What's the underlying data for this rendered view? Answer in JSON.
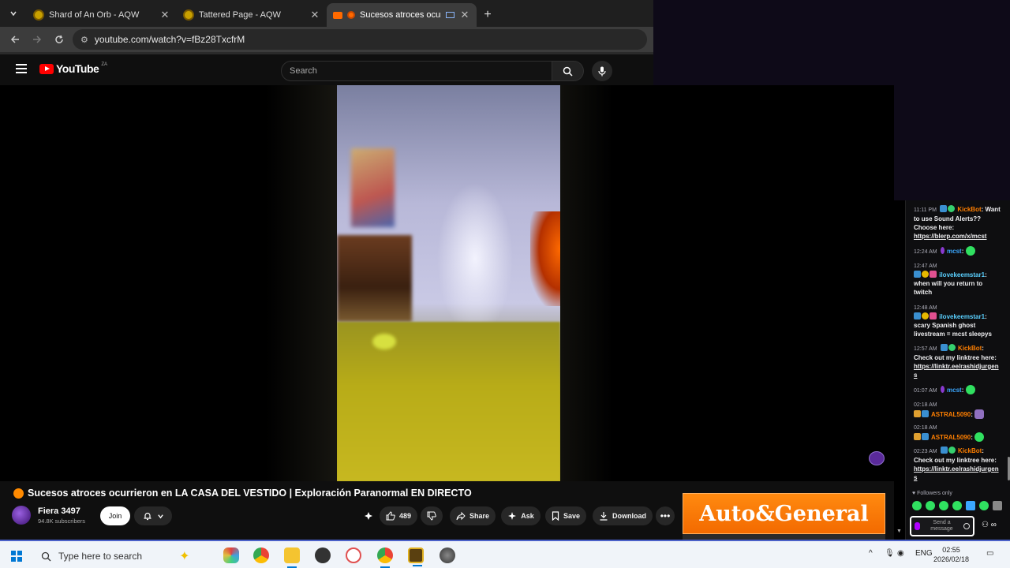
{
  "browser": {
    "tabs": [
      {
        "title": "Shard of An Orb - AQW",
        "favicon": "aqw-icon",
        "active": false
      },
      {
        "title": "Tattered Page - AQW",
        "favicon": "aqw-icon",
        "active": false
      },
      {
        "title": "Sucesos atroces ocurrie",
        "favicon": "youtube-icon",
        "active": true
      }
    ],
    "url": "youtube.com/watch?v=fBz28TxcfrM"
  },
  "youtube": {
    "logo_text": "YouTube",
    "country": "ZA",
    "search_placeholder": "Search"
  },
  "video": {
    "title": "Sucesos atroces ocurrieron en LA CASA DEL VESTIDO | Exploración Paranormal EN DIRECTO",
    "channel": "Fiera 3497",
    "subscribers": "94.8K subscribers",
    "join_label": "Join",
    "like_count": "489",
    "share_label": "Share",
    "ask_label": "Ask",
    "save_label": "Save",
    "download_label": "Download"
  },
  "ad": {
    "text": "Auto&General"
  },
  "chat": {
    "messages": [
      {
        "time": "11:11 PM",
        "user": "KickBot",
        "text": ": Want to use Sound Alerts?? Choose here:",
        "link": "https://blerp.com/x/mcst"
      },
      {
        "time": "12:24 AM",
        "user": "mcst",
        "text": ":"
      },
      {
        "time": "12:47 AM",
        "user": "ilovekeemstar1",
        "text": ": when will you return to twitch"
      },
      {
        "time": "12:48 AM",
        "user": "ilovekeemstar1",
        "text": ": scary Spanish ghost livestream = mcst sleepys"
      },
      {
        "time": "12:57 AM",
        "user": "KickBot",
        "text": ": Check out my linktree here:",
        "link": "https://linktr.ee/rashidjurgens"
      },
      {
        "time": "01:07 AM",
        "user": "mcst",
        "text": ":"
      },
      {
        "time": "02:18 AM",
        "user": "ASTRAL5090",
        "text": ":"
      },
      {
        "time": "02:18 AM",
        "user": "ASTRAL5090",
        "text": ":"
      },
      {
        "time": "02:23 AM",
        "user": "KickBot",
        "text": ": Check out my linktree here:",
        "link": "https://linktr.ee/rashidjurgens"
      }
    ],
    "followers_only": "Followers only",
    "input_placeholder": "Send a message"
  },
  "taskbar": {
    "search_placeholder": "Type here to search",
    "language": "ENG",
    "time": "02:55",
    "date": "2026/02/18"
  }
}
